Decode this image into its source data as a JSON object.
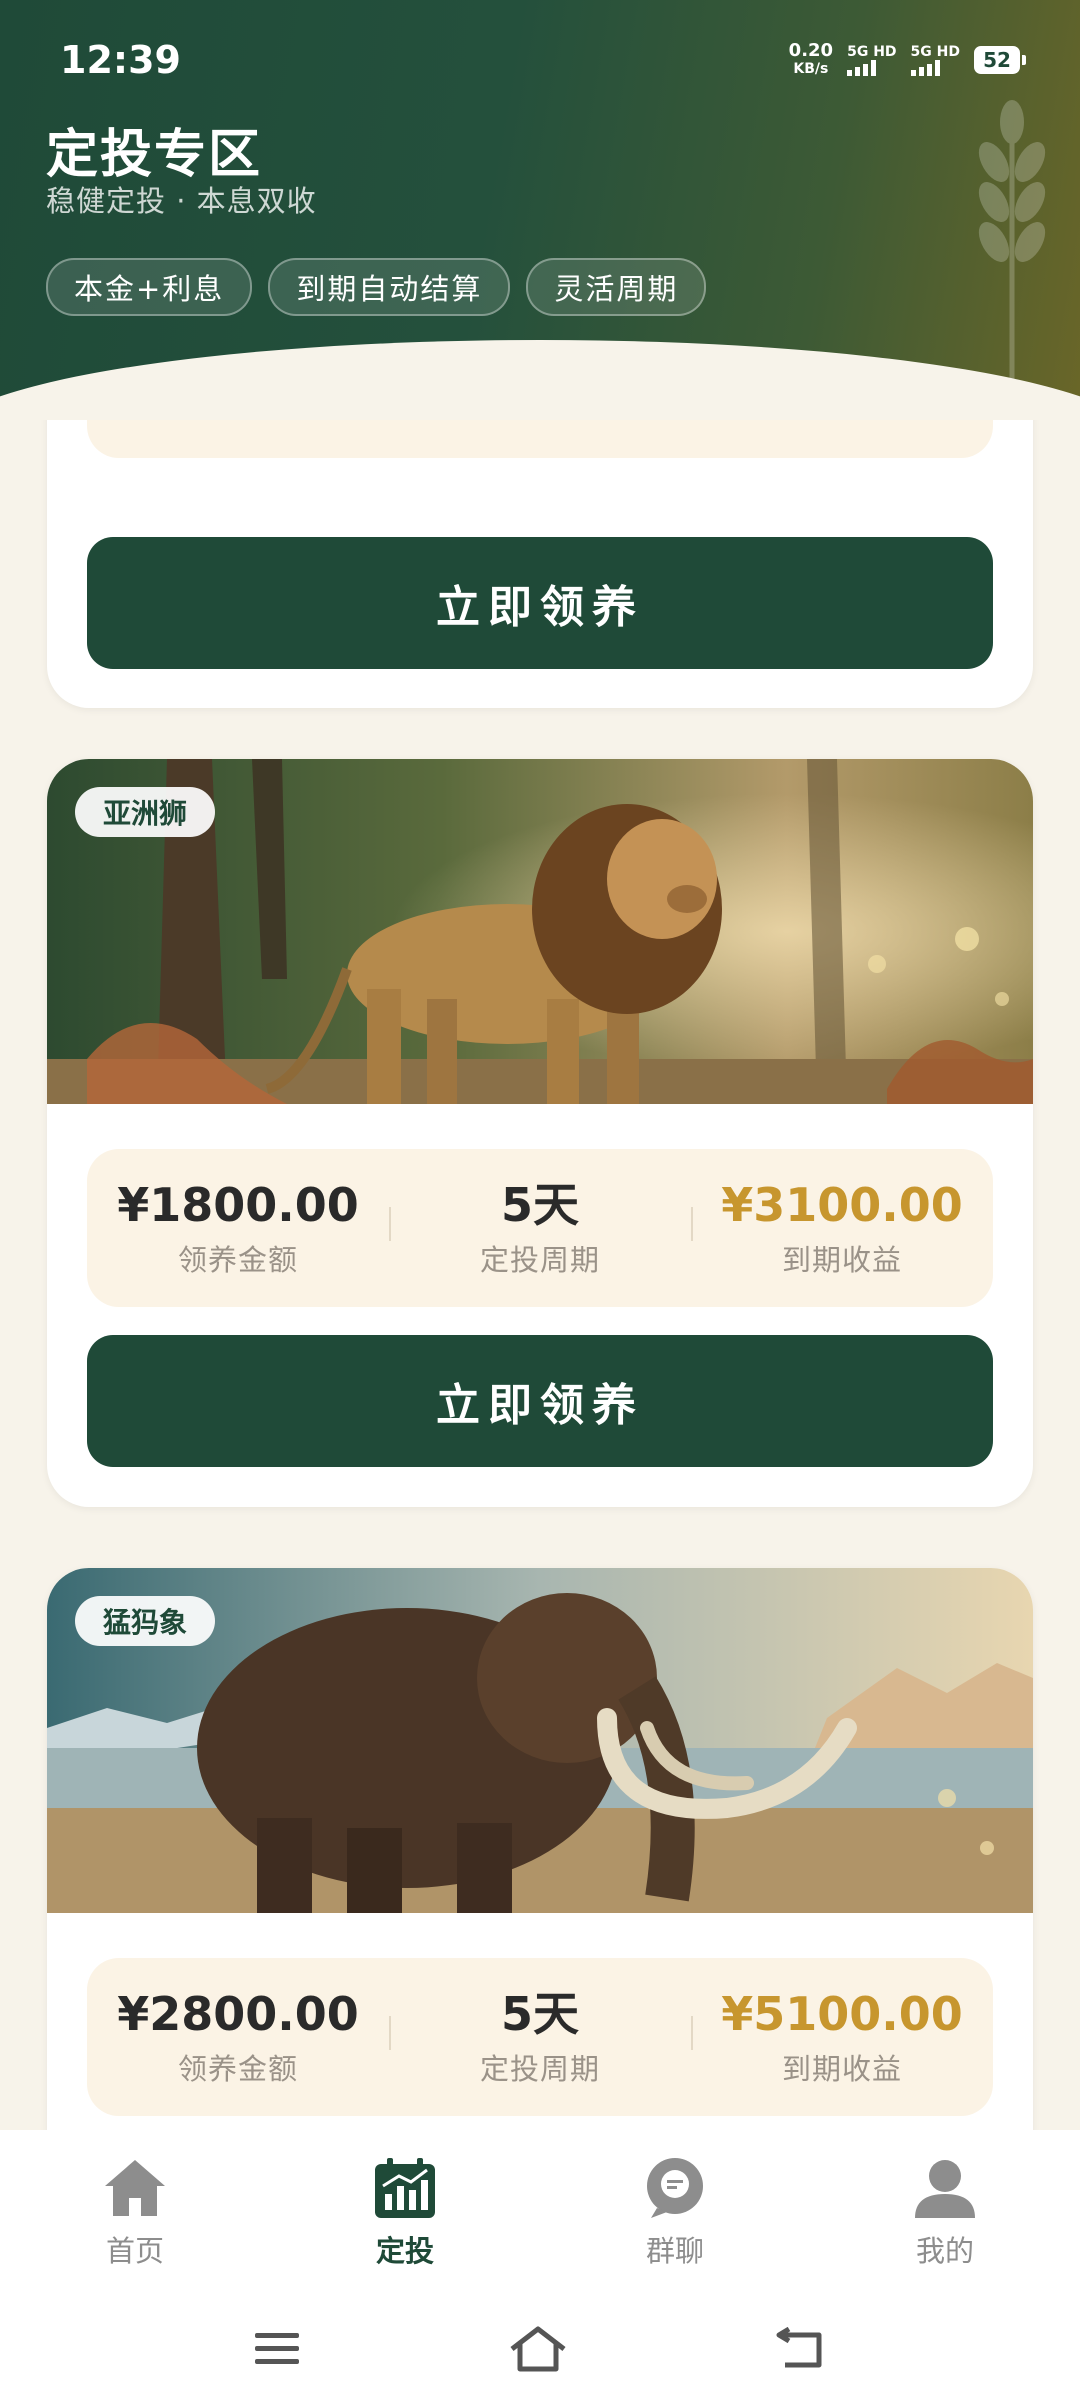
{
  "status": {
    "time": "12:39",
    "net_speed_value": "0.20",
    "net_speed_unit": "KB/s",
    "sim1": "5G HD",
    "sim2": "5G HD",
    "battery": "52"
  },
  "header": {
    "title": "定投专区",
    "subtitle": "稳健定投 · 本息双收",
    "tags": [
      "本金+利息",
      "到期自动结算",
      "灵活周期"
    ]
  },
  "labels": {
    "amount": "领养金额",
    "period": "定投周期",
    "income": "到期收益",
    "adopt_button": "立即领养"
  },
  "cards": [
    {
      "name": "",
      "amount": "",
      "period": "",
      "income": ""
    },
    {
      "name": "亚洲狮",
      "amount": "¥1800.00",
      "period": "5天",
      "income": "¥3100.00"
    },
    {
      "name": "猛犸象",
      "amount": "¥2800.00",
      "period": "5天",
      "income": "¥5100.00"
    }
  ],
  "nav": [
    {
      "label": "首页",
      "icon": "home-icon",
      "active": false
    },
    {
      "label": "定投",
      "icon": "investment-chart-icon",
      "active": true
    },
    {
      "label": "群聊",
      "icon": "chat-bubble-icon",
      "active": false
    },
    {
      "label": "我的",
      "icon": "profile-icon",
      "active": false
    }
  ],
  "colors": {
    "primary": "#1f4a38",
    "gold": "#c7962e",
    "background": "#f7f3ea",
    "stat_bg": "#fbf3e5"
  }
}
